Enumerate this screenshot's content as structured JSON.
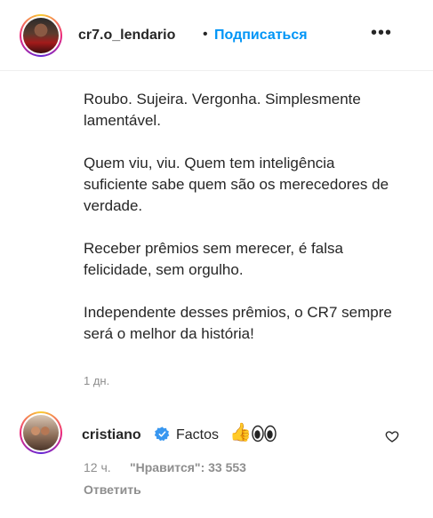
{
  "post": {
    "username": "cr7.o_lendario",
    "separator": "•",
    "follow_label": "Подписаться",
    "more_label": "•••",
    "caption": [
      "Roubo. Sujeira. Vergonha. Simplesmente lamentável.",
      "Quem viu, viu. Quem tem inteligência suficiente sabe quem são os merecedores de verdade.",
      "Receber prêmios sem merecer, é falsa felicidade, sem orgulho.",
      "Independente desses prêmios, o CR7 sempre será o melhor da história!"
    ],
    "time": "1 дн."
  },
  "comment": {
    "username": "cristiano",
    "text": "Factos",
    "emoji_thumb": "👍",
    "time": "12 ч.",
    "likes": "\"Нравится\": 33 553",
    "reply_label": "Ответить"
  },
  "colors": {
    "accent": "#0095f6",
    "verified": "#3897f0",
    "muted": "#8e8e8e",
    "text": "#262626"
  },
  "icons": [
    "more-options-icon",
    "verified-badge-icon",
    "heart-icon",
    "eyes-emoji-icon",
    "thumbs-up-emoji-icon"
  ]
}
